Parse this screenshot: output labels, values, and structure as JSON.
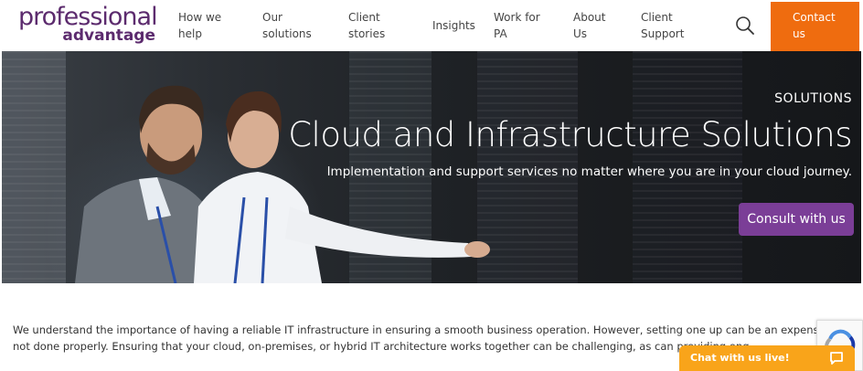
{
  "header": {
    "logo": {
      "line1": "professional",
      "line2": "advantage"
    },
    "nav": [
      {
        "label_line1": "How we",
        "label_line2": "help"
      },
      {
        "label_line1": "Our",
        "label_line2": "solutions"
      },
      {
        "label_line1": "Client",
        "label_line2": "stories"
      },
      {
        "label_line1": "Insights",
        "label_line2": ""
      },
      {
        "label_line1": "Work for",
        "label_line2": "PA"
      },
      {
        "label_line1": "About",
        "label_line2": "Us"
      },
      {
        "label_line1": "Client",
        "label_line2": "Support"
      }
    ],
    "search_icon": "search-icon",
    "contact": {
      "label_line1": "Contact",
      "label_line2": "us"
    }
  },
  "hero": {
    "kicker": "SOLUTIONS",
    "title": "Cloud and Infrastructure Solutions",
    "subtitle": "Implementation and support services no matter where you are in your cloud journey.",
    "cta": "Consult with us"
  },
  "intro": {
    "line1": "We understand the importance of having a reliable IT infrastructure in ensuring a smooth business operation. However, setting one up can be an expensive and risky ex",
    "line2": "not done properly. Ensuring that your cloud, on-premises, or hybrid IT architecture works together can be challenging, as can providing ong"
  },
  "chat": {
    "label": "Chat with us live!",
    "icon": "chat-icon"
  },
  "colors": {
    "brand_purple": "#5c2b6e",
    "contact_orange": "#ef6c0f",
    "cta_purple": "#7b3e97",
    "chat_orange": "#f9a41a"
  }
}
